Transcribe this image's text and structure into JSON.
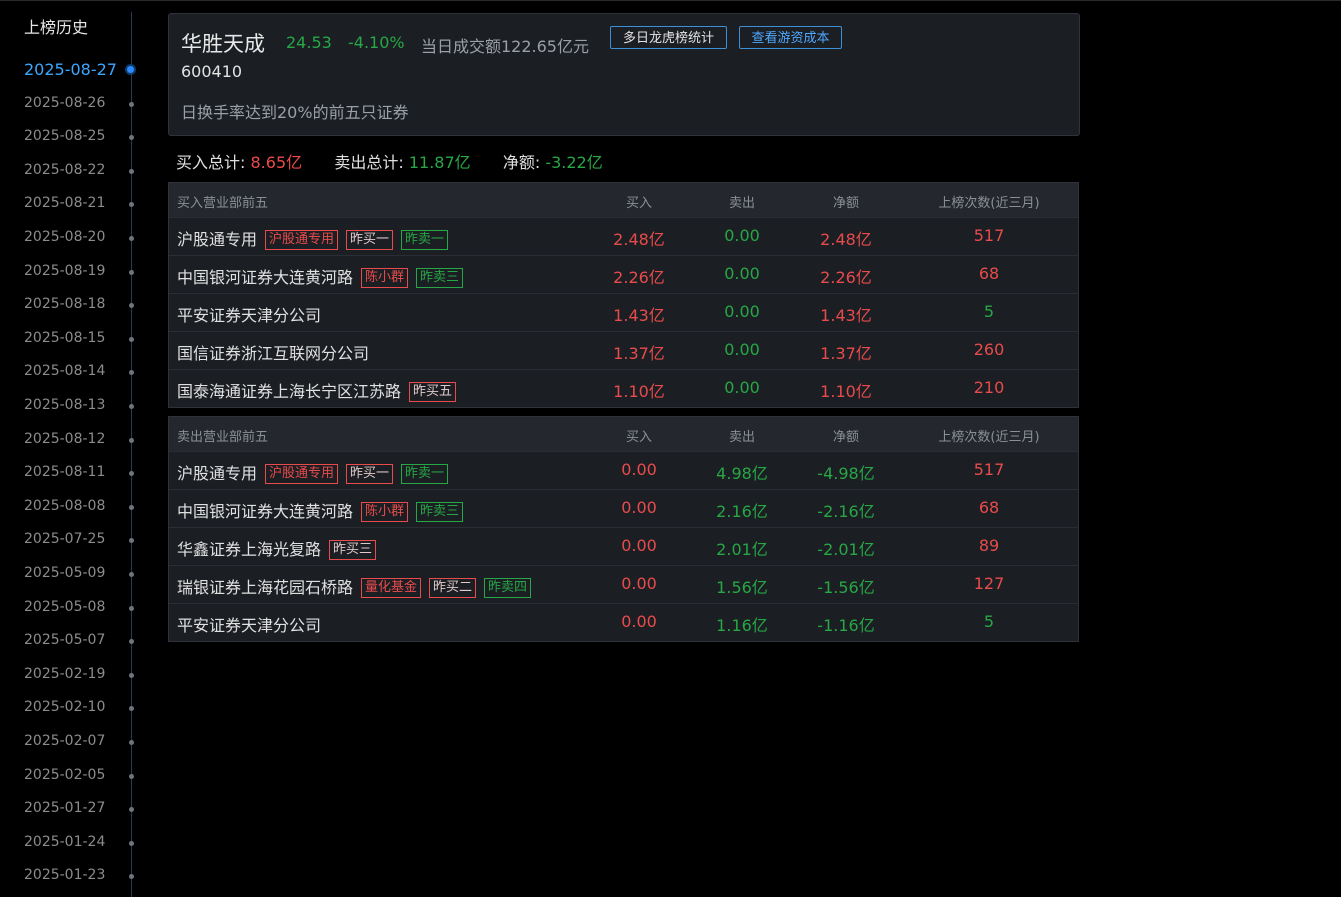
{
  "sidebar": {
    "title": "上榜历史",
    "dates": [
      {
        "label": "2025-08-27",
        "active": true
      },
      {
        "label": "2025-08-26"
      },
      {
        "label": "2025-08-25"
      },
      {
        "label": "2025-08-22"
      },
      {
        "label": "2025-08-21"
      },
      {
        "label": "2025-08-20"
      },
      {
        "label": "2025-08-19"
      },
      {
        "label": "2025-08-18"
      },
      {
        "label": "2025-08-15"
      },
      {
        "label": "2025-08-14"
      },
      {
        "label": "2025-08-13"
      },
      {
        "label": "2025-08-12"
      },
      {
        "label": "2025-08-11"
      },
      {
        "label": "2025-08-08"
      },
      {
        "label": "2025-07-25"
      },
      {
        "label": "2025-05-09"
      },
      {
        "label": "2025-05-08"
      },
      {
        "label": "2025-05-07"
      },
      {
        "label": "2025-02-19"
      },
      {
        "label": "2025-02-10"
      },
      {
        "label": "2025-02-07"
      },
      {
        "label": "2025-02-05"
      },
      {
        "label": "2025-01-27"
      },
      {
        "label": "2025-01-24"
      },
      {
        "label": "2025-01-23"
      }
    ]
  },
  "header": {
    "name": "华胜天成",
    "price": "24.53",
    "change_pct": "-4.10%",
    "turnover": "当日成交额122.65亿元",
    "btn_multi_day": "多日龙虎榜统计",
    "btn_cost": "查看游资成本",
    "code": "600410",
    "reason": "日换手率达到20%的前五只证券"
  },
  "totals": {
    "buy_label": "买入总计:",
    "buy_value": "8.65亿",
    "sell_label": "卖出总计:",
    "sell_value": "11.87亿",
    "net_label": "净额:",
    "net_value": "-3.22亿"
  },
  "buy_table": {
    "headers": {
      "name": "买入营业部前五",
      "buy": "买入",
      "sell": "卖出",
      "net": "净额",
      "count": "上榜次数(近三月)"
    },
    "rows": [
      {
        "name": "沪股通专用",
        "tags": [
          {
            "text": "沪股通专用",
            "style": "r"
          },
          {
            "text": "昨买一",
            "style": "w"
          },
          {
            "text": "昨卖一",
            "style": "g"
          }
        ],
        "buy": "2.48亿",
        "sell": "0.00",
        "net": "2.48亿",
        "count": "517",
        "count_color": "red"
      },
      {
        "name": "中国银河证券大连黄河路",
        "tags": [
          {
            "text": "陈小群",
            "style": "r"
          },
          {
            "text": "昨卖三",
            "style": "g"
          }
        ],
        "buy": "2.26亿",
        "sell": "0.00",
        "net": "2.26亿",
        "count": "68",
        "count_color": "red"
      },
      {
        "name": "平安证券天津分公司",
        "tags": [],
        "buy": "1.43亿",
        "sell": "0.00",
        "net": "1.43亿",
        "count": "5",
        "count_color": "green"
      },
      {
        "name": "国信证券浙江互联网分公司",
        "tags": [],
        "buy": "1.37亿",
        "sell": "0.00",
        "net": "1.37亿",
        "count": "260",
        "count_color": "red"
      },
      {
        "name": "国泰海通证券上海长宁区江苏路",
        "tags": [
          {
            "text": "昨买五",
            "style": "w"
          }
        ],
        "buy": "1.10亿",
        "sell": "0.00",
        "net": "1.10亿",
        "count": "210",
        "count_color": "red"
      }
    ]
  },
  "sell_table": {
    "headers": {
      "name": "卖出营业部前五",
      "buy": "买入",
      "sell": "卖出",
      "net": "净额",
      "count": "上榜次数(近三月)"
    },
    "rows": [
      {
        "name": "沪股通专用",
        "tags": [
          {
            "text": "沪股通专用",
            "style": "r"
          },
          {
            "text": "昨买一",
            "style": "w"
          },
          {
            "text": "昨卖一",
            "style": "g"
          }
        ],
        "buy": "0.00",
        "sell": "4.98亿",
        "net": "-4.98亿",
        "count": "517",
        "count_color": "red"
      },
      {
        "name": "中国银河证券大连黄河路",
        "tags": [
          {
            "text": "陈小群",
            "style": "r"
          },
          {
            "text": "昨卖三",
            "style": "g"
          }
        ],
        "buy": "0.00",
        "sell": "2.16亿",
        "net": "-2.16亿",
        "count": "68",
        "count_color": "red"
      },
      {
        "name": "华鑫证券上海光复路",
        "tags": [
          {
            "text": "昨买三",
            "style": "w"
          }
        ],
        "buy": "0.00",
        "sell": "2.01亿",
        "net": "-2.01亿",
        "count": "89",
        "count_color": "red"
      },
      {
        "name": "瑞银证券上海花园石桥路",
        "tags": [
          {
            "text": "量化基金",
            "style": "r"
          },
          {
            "text": "昨买二",
            "style": "w"
          },
          {
            "text": "昨卖四",
            "style": "g"
          }
        ],
        "buy": "0.00",
        "sell": "1.56亿",
        "net": "-1.56亿",
        "count": "127",
        "count_color": "red"
      },
      {
        "name": "平安证券天津分公司",
        "tags": [],
        "buy": "0.00",
        "sell": "1.16亿",
        "net": "-1.16亿",
        "count": "5",
        "count_color": "green"
      }
    ]
  },
  "colors": {
    "up": "#e84b4b",
    "down": "#27a745",
    "accent": "#3da6ff"
  }
}
